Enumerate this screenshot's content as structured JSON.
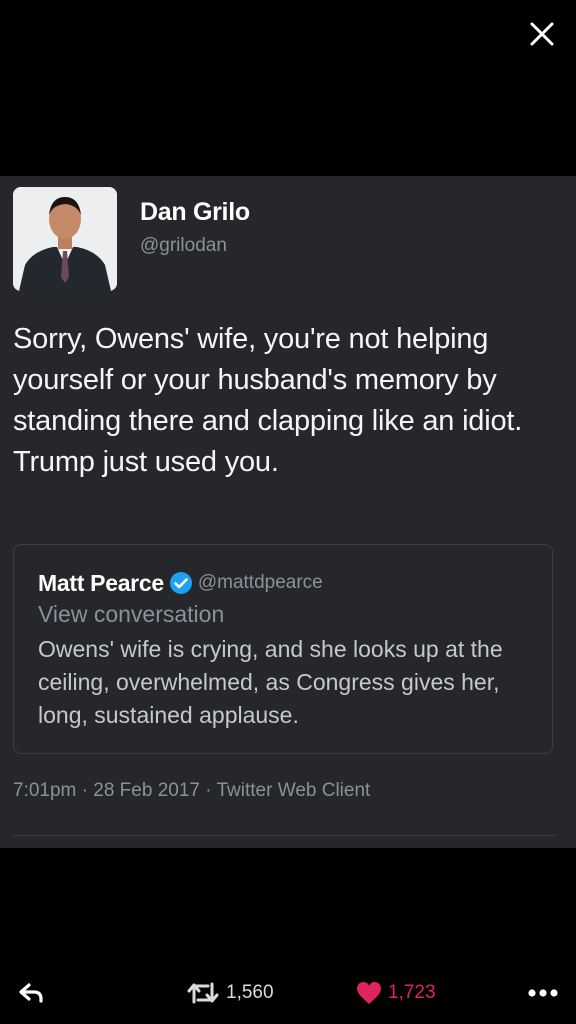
{
  "viewer": {
    "close_icon": "close-icon"
  },
  "tweet": {
    "author": {
      "name": "Dan Grilo",
      "handle": "@grilodan"
    },
    "text": "Sorry, Owens' wife, you're not helping yourself or your husband's memory by standing there and clapping like an idiot. Trump just used you.",
    "quoted": {
      "name": "Matt Pearce",
      "verified_icon": "verified-badge-icon",
      "handle": "@mattdpearce",
      "view_conversation": "View conversation",
      "text": "Owens' wife is crying, and she looks up at the ceiling, overwhelmed, as Congress gives her, long, sustained applause."
    },
    "timestamp": "7:01pm · 28 Feb 2017 · Twitter Web Client"
  },
  "actions": {
    "reply_icon": "reply-icon",
    "retweet_icon": "retweet-icon",
    "retweet_count": "1,560",
    "like_icon": "heart-icon",
    "like_count": "1,723",
    "more_icon": "more-dots-icon"
  },
  "colors": {
    "background": "#000000",
    "card": "#25272b",
    "secondary_text": "#8b9199",
    "like_accent": "#e0245e",
    "verified_blue": "#1da1f2"
  }
}
